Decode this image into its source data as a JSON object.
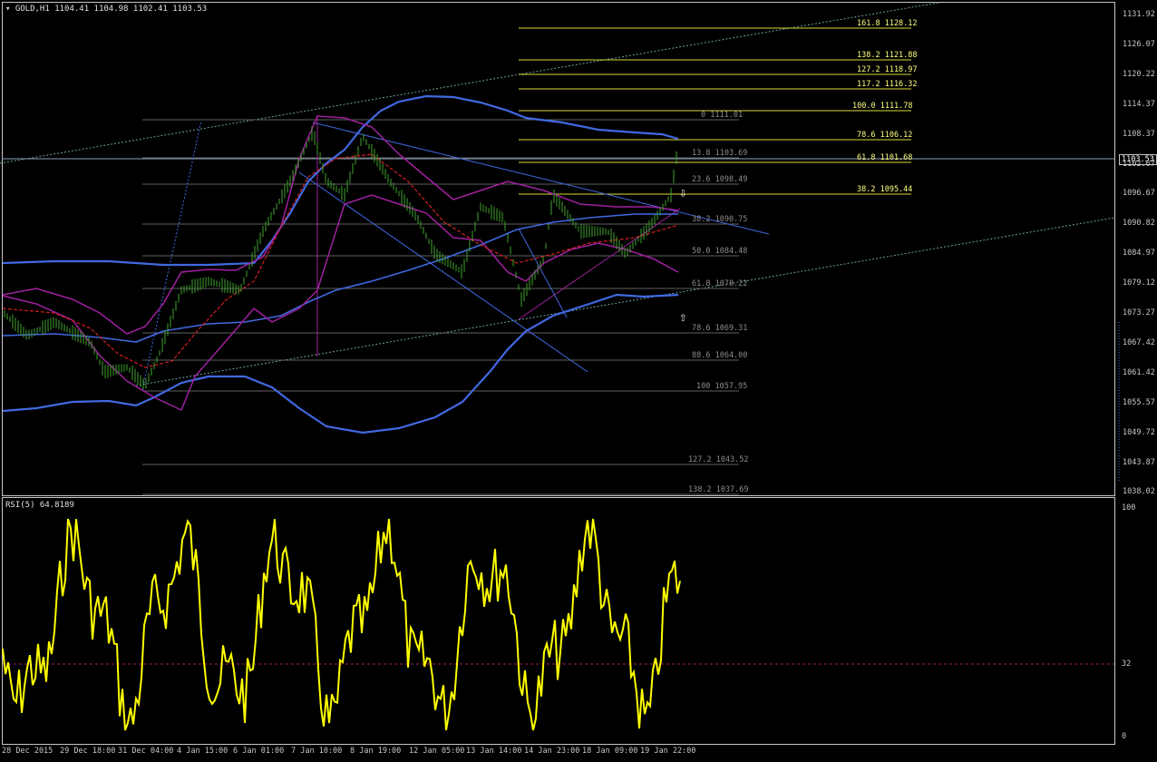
{
  "header": {
    "symbol": "GOLD,H1",
    "ohlc": "1104.41 1104.98 1102.41 1103.53",
    "indicator": "RSI(5) 64.8189"
  },
  "price_axis": [
    "1131.92",
    "1126.07",
    "1120.22",
    "1114.37",
    "1108.37",
    "1102.67",
    "1096.67",
    "1090.82",
    "1084.97",
    "1079.12",
    "1073.27",
    "1067.42",
    "1061.42",
    "1055.57",
    "1049.72",
    "1043.87",
    "1038.02"
  ],
  "current_price": "1103.53",
  "rsi_axis": [
    "100",
    "32",
    "0"
  ],
  "time_axis": [
    "28 Dec 2015",
    "29 Dec 18:00",
    "31 Dec 04:00",
    "4 Jan 15:00",
    "6 Jan 01:00",
    "7 Jan 10:00",
    "8 Jan 19:00",
    "12 Jan 05:00",
    "13 Jan 14:00",
    "14 Jan 23:00",
    "18 Jan 09:00",
    "19 Jan 22:00"
  ],
  "fib_right": [
    {
      "label": "161.8  1128.12"
    },
    {
      "label": "138.2  1121.88"
    },
    {
      "label": "127.2  1118.97"
    },
    {
      "label": "117.2  1116.32"
    },
    {
      "label": "100.0    1111.78"
    },
    {
      "label": "78.6  1106.12"
    },
    {
      "label": "61.8  1101.68"
    },
    {
      "label": "38.2  1095.44"
    }
  ],
  "fib_left": [
    {
      "label": "0  1111.01"
    },
    {
      "label": "13.8  1103.69"
    },
    {
      "label": "23.6  1098.49"
    },
    {
      "label": "38.2  1090.75"
    },
    {
      "label": "50.0  1084.48"
    },
    {
      "label": "61.8  1078.22"
    },
    {
      "label": "78.6  1069.31"
    },
    {
      "label": "88.6  1064.00"
    },
    {
      "label": "100  1057.95"
    },
    {
      "label": "127.2  1043.52"
    },
    {
      "label": "138.2  1037.69"
    }
  ],
  "colors": {
    "background": "#000000",
    "grid_text": "#c8c8c8",
    "candle": "#3fa32c",
    "bollinger_outer": "#4169e1",
    "bollinger_inner": "#a020a0",
    "fib_right": "#e6e62e",
    "fib_left": "#808080",
    "rsi": "#ffff00",
    "level32": "#a0205a",
    "trend_dotted": "#6fa0a0"
  },
  "icons": {
    "down_arrow": "down-arrow-icon",
    "up_arrow": "up-arrow-icon",
    "menu_triangle": "dropdown-triangle-icon"
  }
}
